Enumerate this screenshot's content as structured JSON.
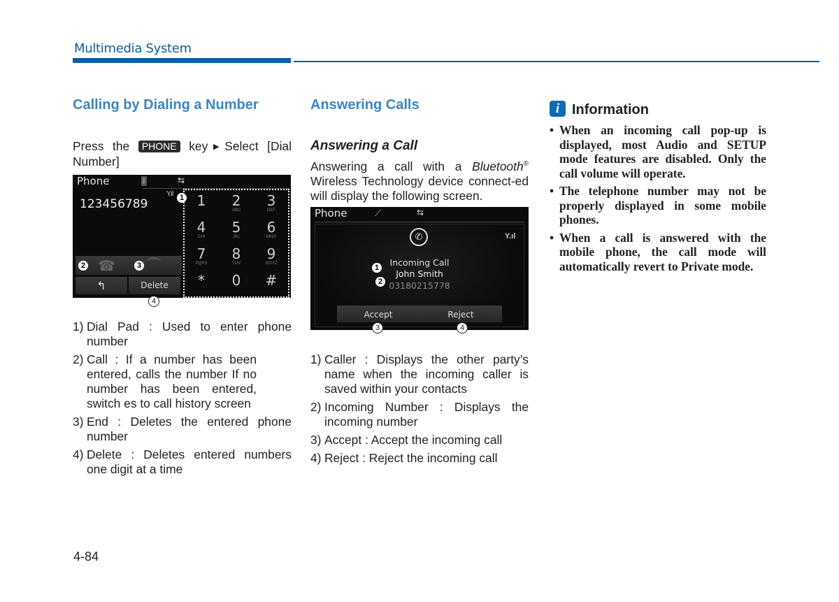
{
  "header": {
    "section_title": "Multimedia System",
    "accent_color": "#0d5ea3"
  },
  "col1": {
    "heading": "Calling by Dialing a Number",
    "intro": {
      "prefix": "Press the",
      "key_label": "PHONE",
      "middle": "key",
      "suffix": "Select [Dial Number]"
    },
    "screen": {
      "title": "Phone",
      "dialed_number": "123456789",
      "status_icons": [
        "bluetooth-icon",
        "usb-icon",
        "signal-icon"
      ],
      "keypad": [
        {
          "digit": "1",
          "letters": ""
        },
        {
          "digit": "2",
          "letters": "ABC"
        },
        {
          "digit": "3",
          "letters": "DEF"
        },
        {
          "digit": "4",
          "letters": "GHI"
        },
        {
          "digit": "5",
          "letters": "JKL"
        },
        {
          "digit": "6",
          "letters": "MNO"
        },
        {
          "digit": "7",
          "letters": "PQRS"
        },
        {
          "digit": "8",
          "letters": "TUV"
        },
        {
          "digit": "9",
          "letters": "WXYZ"
        },
        {
          "digit": "*",
          "letters": ""
        },
        {
          "digit": "0",
          "letters": ""
        },
        {
          "digit": "#",
          "letters": ""
        }
      ],
      "back_icon": "back-arrow-icon",
      "delete_label": "Delete",
      "callouts": {
        "dial_pad": "1",
        "call": "2",
        "end": "3",
        "delete": "4"
      }
    },
    "items": [
      {
        "num": "1)",
        "text": "Dial Pad : Used to enter phone number"
      },
      {
        "num": "2)",
        "text": "Call : If a number has been entered, calls the number If no number has been entered, switch es to call history screen"
      },
      {
        "num": "3)",
        "text": "End : Deletes the entered phone number"
      },
      {
        "num": "4)",
        "text": "Delete : Deletes entered numbers one digit at a time"
      }
    ]
  },
  "col2": {
    "heading": "Answering Calls",
    "subheading": "Answering a Call",
    "intro_prefix": "Answering a call with a ",
    "intro_brand": "Bluetooth",
    "intro_reg": "®",
    "intro_suffix": " Wireless Technology device connect-ed will display the following screen.",
    "screen": {
      "title": "Phone",
      "status_icons": [
        "call-icon",
        "usb-icon",
        "signal-icon"
      ],
      "incoming_label": "Incoming Call",
      "caller_name": "John Smith",
      "caller_number": "03180215778",
      "accept_label": "Accept",
      "reject_label": "Reject",
      "callouts": {
        "caller": "1",
        "number": "2",
        "accept": "3",
        "reject": "4"
      }
    },
    "items": [
      {
        "num": "1)",
        "text": "Caller : Displays the other party’s name when the incoming caller is saved within your contacts"
      },
      {
        "num": "2)",
        "text": "Incoming Number : Displays the incoming number"
      },
      {
        "num": "3)",
        "text": "Accept : Accept the incoming call"
      },
      {
        "num": "4)",
        "text": "Reject : Reject the incoming call"
      }
    ]
  },
  "info": {
    "icon_letter": "i",
    "title": "Information",
    "bullets": [
      "When an incoming call pop-up is displayed, most Audio and SETUP mode features are disabled. Only the call volume will operate.",
      "The telephone number may not be properly displayed in some mobile phones.",
      "When a call is answered with the mobile phone, the call mode will automatically revert to Private mode."
    ]
  },
  "footer": {
    "page_number": "4-84"
  }
}
